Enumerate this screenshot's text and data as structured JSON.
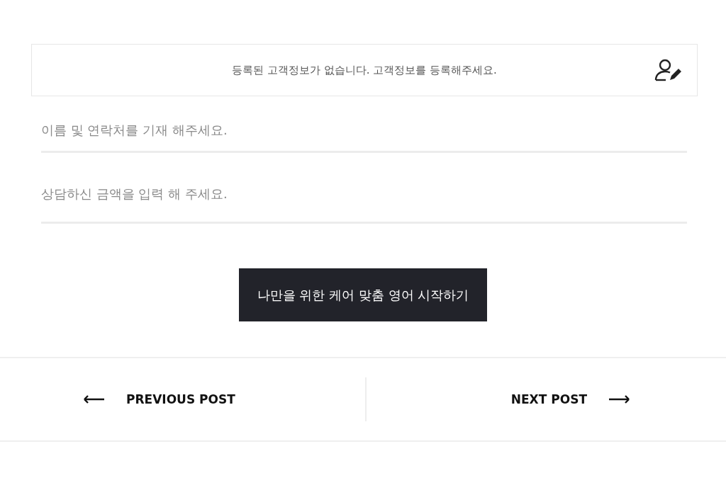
{
  "notice": {
    "text": "등록된 고객정보가 없습니다. 고객정보를 등록해주세요."
  },
  "fields": [
    {
      "placeholder": "이름 및 연락처를 기재 해주세요."
    },
    {
      "placeholder": "상담하신 금액을 입력 해 주세요."
    }
  ],
  "submit_button": {
    "label": "나만을 위한 케어 맞춤 영어 시작하기"
  },
  "post_nav": {
    "previous": "PREVIOUS POST",
    "next": "NEXT POST"
  }
}
